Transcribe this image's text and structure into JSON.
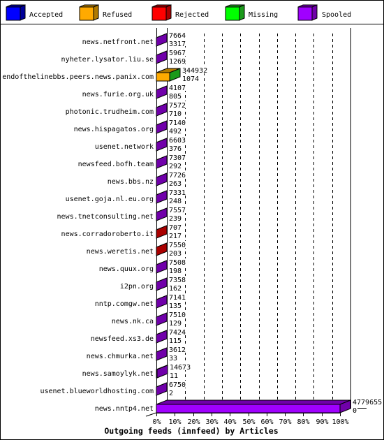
{
  "chart_data": {
    "type": "bar",
    "orientation": "horizontal",
    "stacked": true,
    "style": "3d",
    "title": "Outgoing feeds (innfeed) by Articles",
    "xlabel": "",
    "ylabel": "",
    "xlim": [
      0,
      100
    ],
    "x_unit": "%",
    "x_ticks": [
      "0%",
      "10%",
      "20%",
      "30%",
      "40%",
      "50%",
      "60%",
      "70%",
      "80%",
      "90%",
      "100%"
    ],
    "grid": true,
    "legend_position": "top",
    "legend": [
      {
        "label": "Accepted",
        "color": "#0000ff",
        "shade": "#00009a"
      },
      {
        "label": "Refused",
        "color": "#ffaa00",
        "shade": "#b07a00"
      },
      {
        "label": "Rejected",
        "color": "#ff0000",
        "shade": "#aa0000"
      },
      {
        "label": "Missing",
        "color": "#00ff00",
        "shade": "#1a9a1a"
      },
      {
        "label": "Spooled",
        "color": "#a000ff",
        "shade": "#7000aa"
      }
    ],
    "categories": [
      "news.netfront.net",
      "nyheter.lysator.liu.se",
      "endofthelinebbs.peers.news.panix.com",
      "news.furie.org.uk",
      "photonic.trudheim.com",
      "news.hispagatos.org",
      "usenet.network",
      "newsfeed.bofh.team",
      "news.bbs.nz",
      "usenet.goja.nl.eu.org",
      "news.tnetconsulting.net",
      "news.corradoroberto.it",
      "news.weretis.net",
      "news.quux.org",
      "i2pn.org",
      "nntp.comgw.net",
      "news.nk.ca",
      "newsfeed.xs3.de",
      "news.chmurka.net",
      "news.samoylyk.net",
      "usenet.blueworldhosting.com",
      "news.nntp4.net"
    ],
    "feeds": [
      {
        "name": "news.netfront.net",
        "upper_value": 7664,
        "lower_value": 3317,
        "front_segment": "Spooled",
        "end_segment": "Spooled"
      },
      {
        "name": "nyheter.lysator.liu.se",
        "upper_value": 5967,
        "lower_value": 1269,
        "front_segment": "Spooled",
        "end_segment": "Spooled"
      },
      {
        "name": "endofthelinebbs.peers.news.panix.com",
        "upper_value": 344932,
        "lower_value": 1074,
        "front_segment": "Refused",
        "end_segment": "Missing"
      },
      {
        "name": "news.furie.org.uk",
        "upper_value": 4107,
        "lower_value": 805,
        "front_segment": "Spooled",
        "end_segment": "Spooled"
      },
      {
        "name": "photonic.trudheim.com",
        "upper_value": 7572,
        "lower_value": 710,
        "front_segment": "Spooled",
        "end_segment": "Spooled"
      },
      {
        "name": "news.hispagatos.org",
        "upper_value": 7140,
        "lower_value": 492,
        "front_segment": "Spooled",
        "end_segment": "Spooled"
      },
      {
        "name": "usenet.network",
        "upper_value": 6603,
        "lower_value": 376,
        "front_segment": "Spooled",
        "end_segment": "Spooled"
      },
      {
        "name": "newsfeed.bofh.team",
        "upper_value": 7307,
        "lower_value": 292,
        "front_segment": "Spooled",
        "end_segment": "Spooled"
      },
      {
        "name": "news.bbs.nz",
        "upper_value": 7726,
        "lower_value": 263,
        "front_segment": "Spooled",
        "end_segment": "Spooled"
      },
      {
        "name": "usenet.goja.nl.eu.org",
        "upper_value": 7331,
        "lower_value": 248,
        "front_segment": "Spooled",
        "end_segment": "Spooled"
      },
      {
        "name": "news.tnetconsulting.net",
        "upper_value": 7557,
        "lower_value": 239,
        "front_segment": "Spooled",
        "end_segment": "Spooled"
      },
      {
        "name": "news.corradoroberto.it",
        "upper_value": 707,
        "lower_value": 217,
        "front_segment": "Rejected",
        "end_segment": "Rejected"
      },
      {
        "name": "news.weretis.net",
        "upper_value": 7550,
        "lower_value": 203,
        "front_segment": "Rejected",
        "end_segment": "Rejected"
      },
      {
        "name": "news.quux.org",
        "upper_value": 7508,
        "lower_value": 198,
        "front_segment": "Spooled",
        "end_segment": "Spooled"
      },
      {
        "name": "i2pn.org",
        "upper_value": 7358,
        "lower_value": 162,
        "front_segment": "Spooled",
        "end_segment": "Spooled"
      },
      {
        "name": "nntp.comgw.net",
        "upper_value": 7141,
        "lower_value": 135,
        "front_segment": "Spooled",
        "end_segment": "Spooled"
      },
      {
        "name": "news.nk.ca",
        "upper_value": 7510,
        "lower_value": 129,
        "front_segment": "Spooled",
        "end_segment": "Spooled"
      },
      {
        "name": "newsfeed.xs3.de",
        "upper_value": 7424,
        "lower_value": 115,
        "front_segment": "Spooled",
        "end_segment": "Spooled"
      },
      {
        "name": "news.chmurka.net",
        "upper_value": 3612,
        "lower_value": 33,
        "front_segment": "Spooled",
        "end_segment": "Spooled"
      },
      {
        "name": "news.samoylyk.net",
        "upper_value": 14673,
        "lower_value": 11,
        "front_segment": "Spooled",
        "end_segment": "Spooled"
      },
      {
        "name": "usenet.blueworldhosting.com",
        "upper_value": 6750,
        "lower_value": 2,
        "front_segment": "Spooled",
        "end_segment": "Spooled"
      },
      {
        "name": "news.nntp4.net",
        "upper_value": 4779655,
        "lower_value": 0,
        "front_segment": "Spooled",
        "end_segment": "Spooled"
      }
    ]
  }
}
